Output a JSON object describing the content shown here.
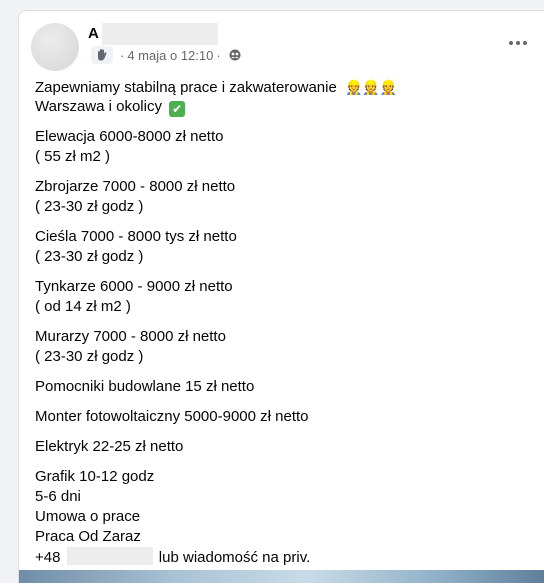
{
  "post": {
    "author_initial": "A",
    "date": "4 maja o 12:10",
    "separator": "·",
    "privacy_icon": "friends-icon",
    "badge_icon": "wave-hand-icon",
    "more_icon": "more-dots-icon"
  },
  "content": {
    "intro_line1": "Zapewniamy stabilną prace i zakwaterowanie",
    "intro_emojis": "👷👷👷",
    "intro_line2": "Warszawa i okolicy",
    "intro_check": "✔",
    "jobs": [
      {
        "title": "Elewacja 6000-8000 zł netto",
        "detail": "( 55 zł m2 )"
      },
      {
        "title": "Zbrojarze 7000 - 8000 zł netto",
        "detail": "( 23-30 zł godz )"
      },
      {
        "title": "Cieśla 7000 - 8000 tys zł netto",
        "detail": "( 23-30 zł godz )"
      },
      {
        "title": "Tynkarze 6000 - 9000 zł netto",
        "detail": "( od 14 zł m2 )"
      },
      {
        "title": "Murarzy 7000 - 8000 zł netto",
        "detail": "( 23-30 zł godz )"
      }
    ],
    "single_lines": [
      "Pomocniki budowlane 15 zł netto",
      "Monter fotowoltaiczny 5000-9000 zł netto",
      "Elektryk 22-25 zł netto"
    ],
    "final_block": [
      "Grafik 10-12 godz",
      "5-6 dni",
      "Umowa o prace",
      "Praca Od Zaraz"
    ],
    "phone_prefix": "+48",
    "phone_suffix": "lub wiadomość na priv."
  }
}
